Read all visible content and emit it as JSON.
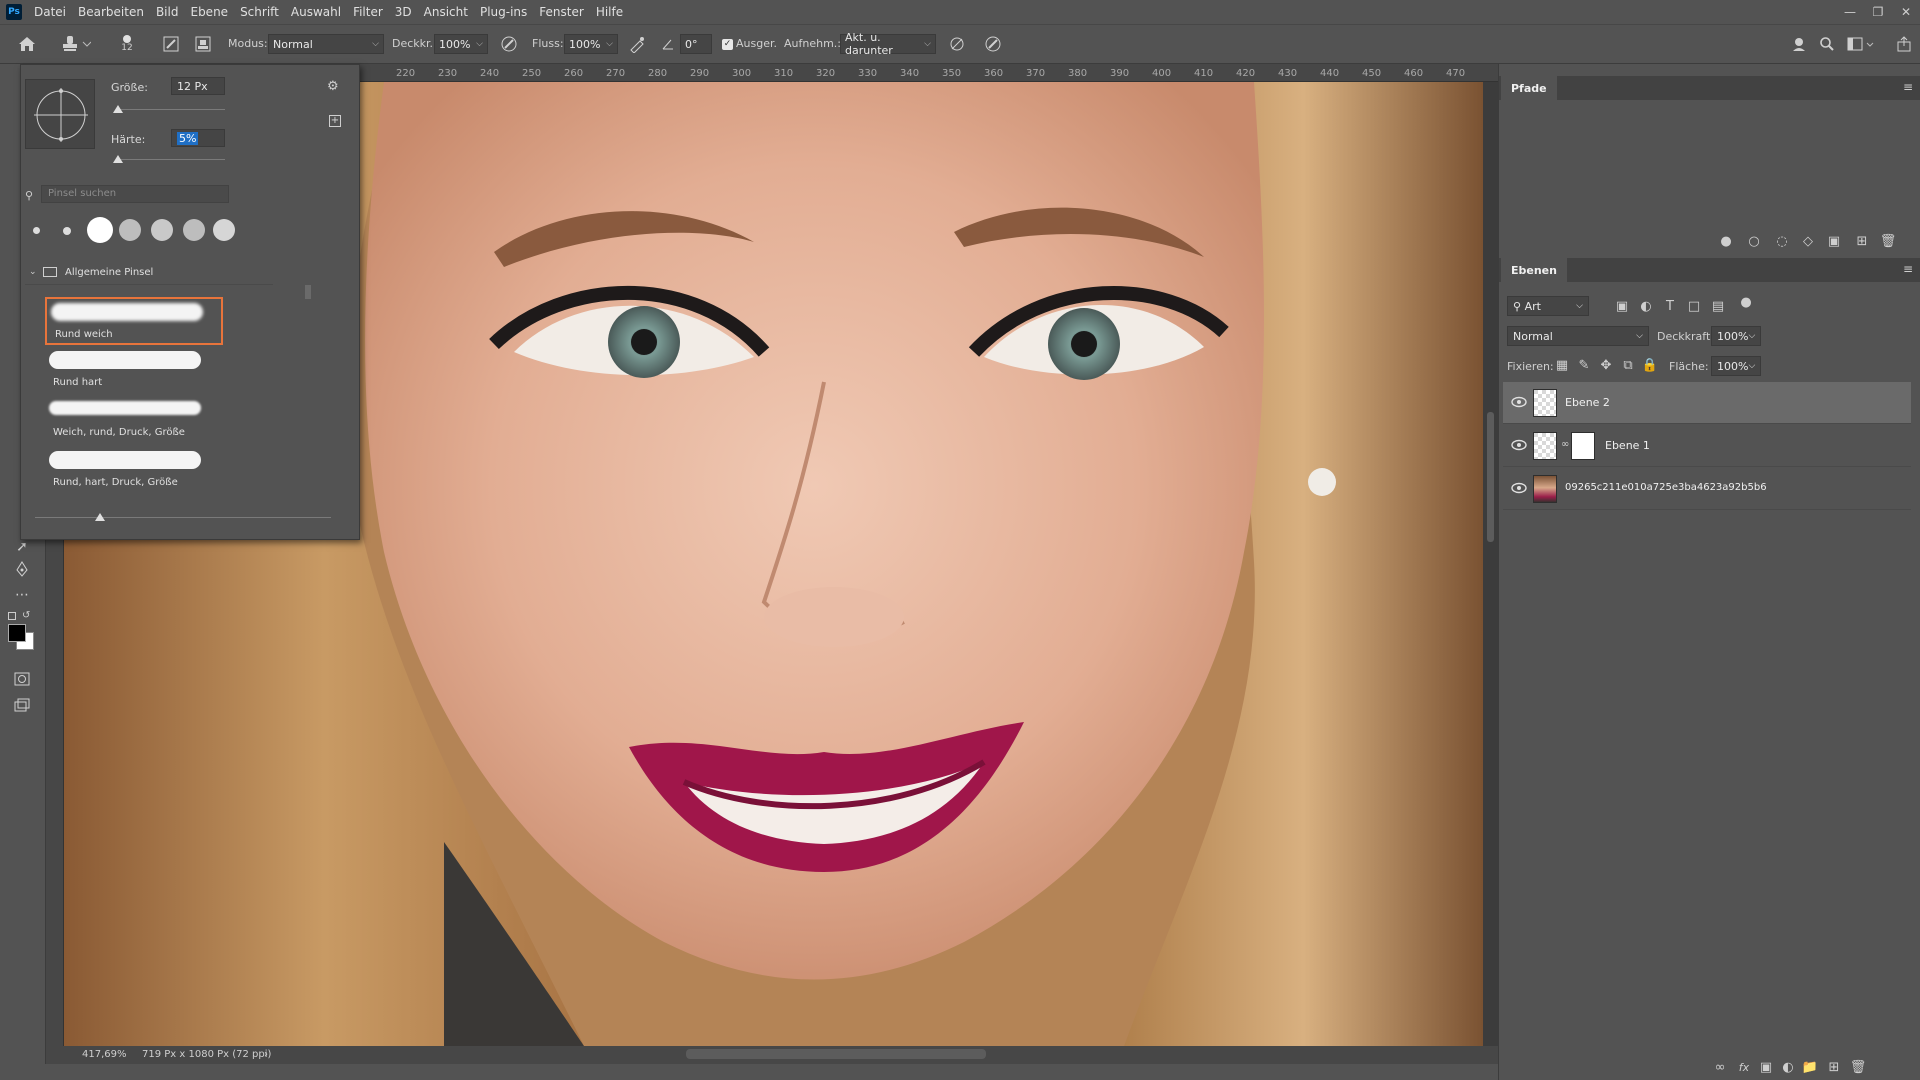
{
  "menubar": {
    "logo": "Ps",
    "items": [
      "Datei",
      "Bearbeiten",
      "Bild",
      "Ebene",
      "Schrift",
      "Auswahl",
      "Filter",
      "3D",
      "Ansicht",
      "Plug-ins",
      "Fenster",
      "Hilfe"
    ]
  },
  "optionsbar": {
    "brush_size_label": "12",
    "mode_label": "Modus:",
    "mode_value": "Normal",
    "opacity_label": "Deckkr.:",
    "opacity_value": "100%",
    "flow_label": "Fluss:",
    "flow_value": "100%",
    "angle_value": "0°",
    "align_label": "Ausger.",
    "sample_label": "Aufnehm.:",
    "sample_value": "Akt. u. darunter"
  },
  "brush_panel": {
    "size_label": "Größe:",
    "size_value": "12 Px",
    "hardness_label": "Härte:",
    "hardness_value": "5%",
    "search_placeholder": "Pinsel suchen",
    "folder_name": "Allgemeine Pinsel",
    "brushes": [
      {
        "name": "Rund weich"
      },
      {
        "name": "Rund hart"
      },
      {
        "name": "Weich, rund, Druck, Größe"
      },
      {
        "name": "Rund, hart, Druck, Größe"
      }
    ]
  },
  "ruler": {
    "ticks": [
      "220",
      "230",
      "240",
      "250",
      "260",
      "270",
      "280",
      "290",
      "300",
      "310",
      "320",
      "330",
      "340",
      "350",
      "360",
      "370",
      "380",
      "390",
      "400",
      "410",
      "420",
      "430",
      "440",
      "450",
      "460",
      "470"
    ]
  },
  "status": {
    "zoom": "417,69%",
    "doc_info": "719 Px x 1080 Px (72 ppi)"
  },
  "paths_panel": {
    "title": "Pfade"
  },
  "layers_panel": {
    "title": "Ebenen",
    "filter_value": "Art",
    "blend_mode": "Normal",
    "opacity_label": "Deckkraft:",
    "opacity_value": "100%",
    "lock_label": "Fixieren:",
    "fill_label": "Fläche:",
    "fill_value": "100%",
    "layers": [
      {
        "name": "Ebene 2",
        "active": true
      },
      {
        "name": "Ebene 1",
        "active": false
      },
      {
        "name": "09265c211e010a725e3ba4623a92b5b6",
        "active": false
      }
    ]
  },
  "colors": {
    "ui_bg": "#535353",
    "active_brush_border": "#e8743b",
    "lip_color": "#a0164a",
    "hardness_highlight": "#1f6fc5"
  }
}
